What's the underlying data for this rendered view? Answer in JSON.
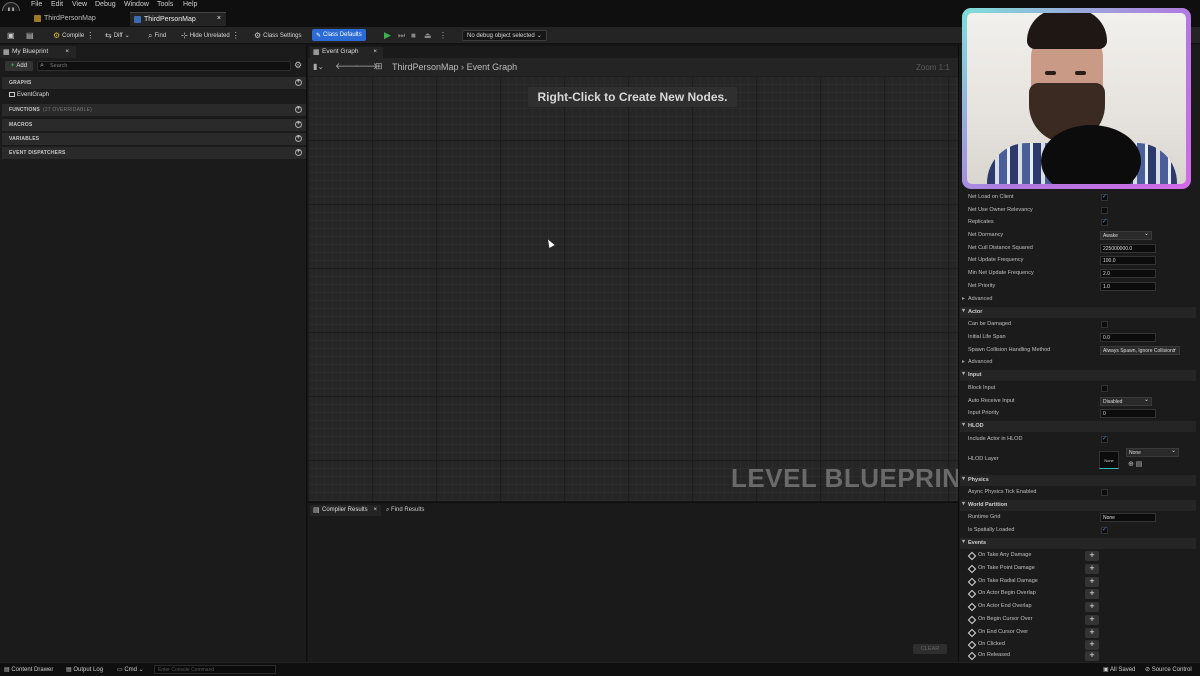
{
  "menu": {
    "items": [
      "File",
      "Edit",
      "View",
      "Debug",
      "Window",
      "Tools",
      "Help"
    ],
    "logo": "U"
  },
  "doc_tabs": [
    {
      "label": "ThirdPersonMap",
      "active": false
    },
    {
      "label": "ThirdPersonMap",
      "active": true,
      "close": "×"
    }
  ],
  "toolbar": {
    "compile": "Compile",
    "diff": "Diff",
    "find": "Find",
    "hide_unrelated": "Hide Unrelated",
    "class_settings": "Class Settings",
    "class_defaults": "Class Defaults",
    "debug_select": "No debug object selected"
  },
  "my_blueprint": {
    "tab": "My Blueprint",
    "add": "Add",
    "search_placeholder": "Search",
    "graphs_header": "GRAPHS",
    "event_graph_item": "EventGraph",
    "functions_header": "FUNCTIONS",
    "functions_sub": "(27 OVERRIDABLE)",
    "macros_header": "MACROS",
    "variables_header": "VARIABLES",
    "dispatchers_header": "EVENT DISPATCHERS"
  },
  "graph": {
    "tab": "Event Graph",
    "breadcrumb_root": "ThirdPersonMap",
    "breadcrumb_sep": "›",
    "breadcrumb_leaf": "Event Graph",
    "zoom": "Zoom 1:1",
    "hint": "Right-Click to Create New Nodes.",
    "watermark": "LEVEL BLUEPRINT"
  },
  "results": {
    "compiler_tab": "Compiler Results",
    "find_tab": "Find Results",
    "clear": "CLEAR"
  },
  "details": {
    "rows": [
      {
        "label": "Net Load on Client",
        "type": "check",
        "value": "✓"
      },
      {
        "label": "Net Use Owner Relevancy",
        "type": "check",
        "value": ""
      },
      {
        "label": "Replicates",
        "type": "check",
        "value": "✓"
      },
      {
        "label": "Net Dormancy",
        "type": "select",
        "value": "Awake"
      },
      {
        "label": "Net Cull Distance Squared",
        "type": "input",
        "value": "225000000.0"
      },
      {
        "label": "Net Update Frequency",
        "type": "input",
        "value": "100.0"
      },
      {
        "label": "Min Net Update Frequency",
        "type": "input",
        "value": "2.0"
      },
      {
        "label": "Net Priority",
        "type": "input",
        "value": "1.0"
      }
    ],
    "advanced_label": "Advanced",
    "actor_cat": "Actor",
    "can_be_damaged": "Can be Damaged",
    "initial_life_span": "Initial Life Span",
    "initial_life_span_value": "0.0",
    "spawn_collision": "Spawn Collision Handling Method",
    "spawn_collision_value": "Always Spawn, Ignore Collisions",
    "input_cat": "Input",
    "block_input": "Block Input",
    "auto_receive": "Auto Receive Input",
    "auto_receive_value": "Disabled",
    "input_priority": "Input Priority",
    "input_priority_value": "0",
    "hlod_cat": "HLOD",
    "include_in_hlod": "Include Actor in HLOD",
    "hlod_layer": "HLOD Layer",
    "hlod_none_swatch": "None",
    "hlod_none_select": "None",
    "physics_cat": "Physics",
    "async_physics": "Async Physics Tick Enabled",
    "world_partition_cat": "World Partition",
    "runtime_grid": "Runtime Grid",
    "runtime_grid_value": "None",
    "spatially_loaded": "Is Spatially Loaded",
    "events_cat": "Events",
    "events": [
      "On Take Any Damage",
      "On Take Point Damage",
      "On Take Radial Damage",
      "On Actor Begin Overlap",
      "On Actor End Overlap",
      "On Begin Cursor Over",
      "On End Cursor Over",
      "On Clicked",
      "On Released"
    ]
  },
  "status": {
    "content_drawer": "Content Drawer",
    "output_log": "Output Log",
    "cmd": "Cmd",
    "console_placeholder": "Enter Console Command",
    "all_saved": "All Saved",
    "source_control": "Source Control"
  }
}
